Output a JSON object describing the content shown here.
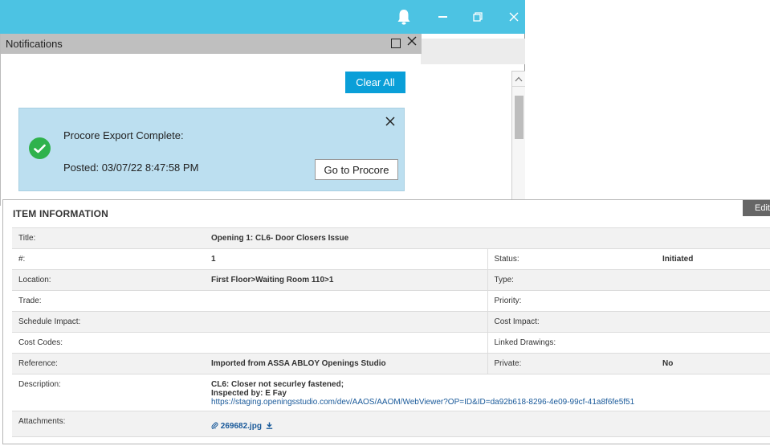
{
  "notifications": {
    "title": "Notifications",
    "clear_all": "Clear All",
    "card": {
      "title": "Procore Export Complete:",
      "posted": "Posted: 03/07/22 8:47:58 PM",
      "button": "Go to Procore"
    }
  },
  "item": {
    "section_title": "ITEM INFORMATION",
    "edit_label": "Edit",
    "rows": {
      "title": {
        "label": "Title:",
        "value": "Opening 1: CL6- Door Closers Issue"
      },
      "number": {
        "label": "#:",
        "value": "1",
        "label2": "Status:",
        "value2": "Initiated"
      },
      "location": {
        "label": "Location:",
        "value": "First Floor>Waiting Room 110>1",
        "label2": "Type:",
        "value2": ""
      },
      "trade": {
        "label": "Trade:",
        "value": "",
        "label2": "Priority:",
        "value2": ""
      },
      "schedule": {
        "label": "Schedule Impact:",
        "value": "",
        "label2": "Cost Impact:",
        "value2": ""
      },
      "cost_codes": {
        "label": "Cost Codes:",
        "value": "",
        "label2": "Linked Drawings:",
        "value2": ""
      },
      "reference": {
        "label": "Reference:",
        "value": "Imported from ASSA ABLOY Openings Studio",
        "label2": "Private:",
        "value2": "No"
      },
      "description": {
        "label": "Description:",
        "line1": "CL6: Closer not securley fastened;",
        "line2": "Inspected by: E Fay",
        "link": "https://staging.openingsstudio.com/dev/AAOS/AAOM/WebViewer?OP=ID&ID=da92b618-8296-4e09-99cf-41a8f6fe5f51"
      },
      "attachments": {
        "label": "Attachments:",
        "file": "269682.jpg"
      }
    }
  },
  "colors": {
    "titlebar": "#4cc3e3",
    "accent_button": "#0a9fd8",
    "card_bg": "#bcdff0",
    "success": "#2fb24c"
  }
}
